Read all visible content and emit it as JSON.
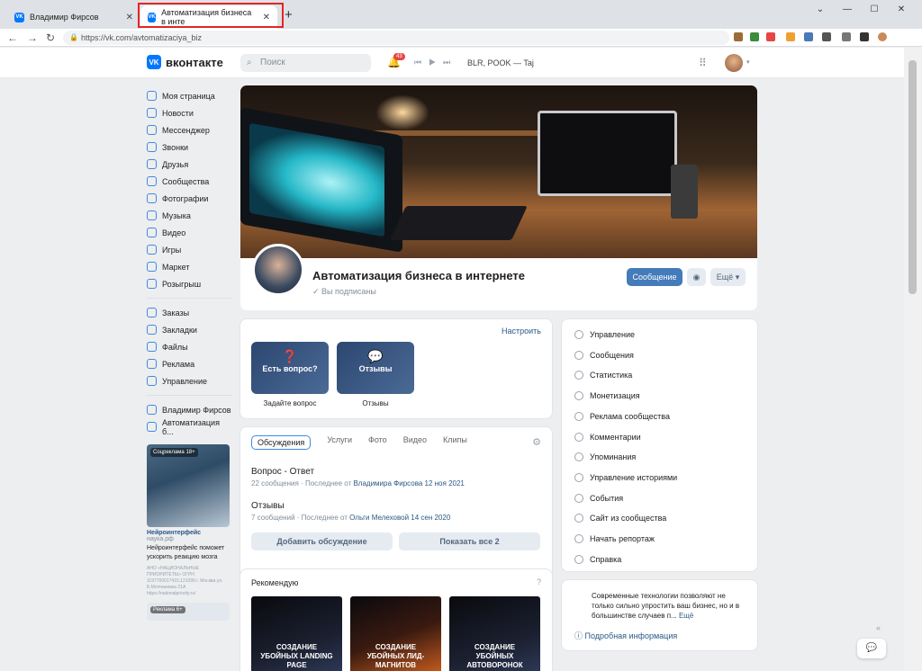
{
  "browser": {
    "tab1": "Владимир Фирсов",
    "tab2": "Автоматизация бизнеса в инте",
    "url": "https://vk.com/avtomatizaciya_biz"
  },
  "vk": {
    "logo": "вконтакте",
    "search_placeholder": "Поиск",
    "notifications": "43",
    "track": "BLR, POOK — Taj"
  },
  "sidebar": [
    "Моя страница",
    "Новости",
    "Мессенджер",
    "Звонки",
    "Друзья",
    "Сообщества",
    "Фотографии",
    "Музыка",
    "Видео",
    "Игры",
    "Маркет",
    "Розыгрыш"
  ],
  "sidebar2": [
    "Заказы",
    "Закладки",
    "Файлы",
    "Реклама",
    "Управление"
  ],
  "sidebar3": [
    "Владимир Фирсов",
    "Автоматизация б..."
  ],
  "ad": {
    "tag": "Соцреклама 18+",
    "title": "Нейроинтерфейс",
    "site": "наука.рф",
    "body": "Нейроинтерфейс поможет ускорить реакцию мозга",
    "small": "АНО «НАЦИОНАЛЬНЫЕ ПРИОРИТЕТЫ» ОГРН 1197700017415,121099 г. Москва ул. Б.Молчановка 21А https://nationalpriority.ru/",
    "tag2": "Реклама 6+"
  },
  "group": {
    "name": "Автоматизация бизнеса в интернете",
    "status": "Вы подписаны",
    "btn_message": "Сообщение",
    "btn_more": "Ещё"
  },
  "tiles": {
    "settings": "Настроить",
    "t1": "Есть вопрос?",
    "c1": "Задайте вопрос",
    "t2": "Отзывы",
    "c2": "Отзывы"
  },
  "tabs": [
    "Обсуждения",
    "Услуги",
    "Фото",
    "Видео",
    "Клипы"
  ],
  "disc": [
    {
      "title": "Вопрос - Ответ",
      "meta": "22 сообщения · Последнее от ",
      "who": "Владимира Фирсова 12 ноя 2021"
    },
    {
      "title": "Отзывы",
      "meta": "7 сообщений · Последнее от ",
      "who": "Ольги Мелеховой 14 сен 2020"
    }
  ],
  "disc_btns": {
    "add": "Добавить обсуждение",
    "all": "Показать все 2"
  },
  "rec": {
    "title": "Рекомендую",
    "items": [
      "СОЗДАНИЕ УБОЙНЫХ LANDING PAGE",
      "СОЗДАНИЕ УБОЙНЫХ ЛИД-МАГНИТОВ",
      "СОЗДАНИЕ УБОЙНЫХ АВТОВОРОНОК"
    ]
  },
  "menu": [
    "Управление",
    "Сообщения",
    "Статистика",
    "Монетизация",
    "Реклама сообщества",
    "Комментарии",
    "Упоминания",
    "Управление историями",
    "События",
    "Сайт из сообщества",
    "Начать репортаж",
    "Справка"
  ],
  "info": {
    "text": "Современные технологии позволяют не только сильно упростить ваш бизнес, но и в большинстве случаев п...",
    "more": "Ещё",
    "link": "Подробная информация"
  }
}
